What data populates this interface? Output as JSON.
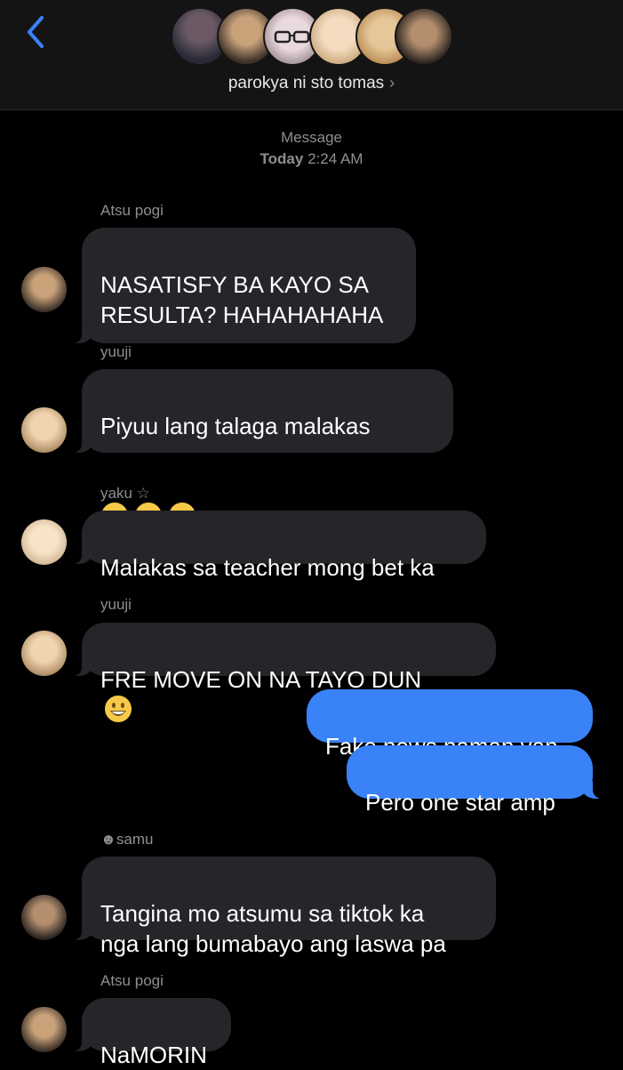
{
  "header": {
    "back_icon": "chevron-left-icon",
    "group_name": "parokya ni sto tomas",
    "chevron": "›",
    "accent": "#3a82f7"
  },
  "timestamp": {
    "label": "Message",
    "day": "Today",
    "time": "2:24 AM"
  },
  "messages": [
    {
      "sender": "Atsu pogi",
      "text": "NASATISFY BA KAYO SA\nRESULTA? HAHAHAHAHA"
    },
    {
      "sender": "yuuji",
      "text": "Piyuu lang talaga malakas",
      "emoji": "relieved-face-emoji x3"
    },
    {
      "sender": "yaku ☆",
      "text": "Malakas sa teacher mong bet ka"
    },
    {
      "sender": "yuuji",
      "text": "FRE MOVE ON NA TAYO DUN",
      "emoji": "grinning-face-emoji"
    },
    {
      "sender": "me",
      "text": "Fake news naman yan"
    },
    {
      "sender": "me",
      "text": "Pero one star amp"
    },
    {
      "sender": "☻samu",
      "text": "Tangina mo atsumu sa tiktok ka\nnga lang bumabayo ang laswa pa"
    },
    {
      "sender": "Atsu pogi",
      "text": "NaMORIN"
    }
  ],
  "colors": {
    "incoming_bubble": "#26252a",
    "outgoing_bubble": "#3a82f7",
    "background": "#000000"
  }
}
